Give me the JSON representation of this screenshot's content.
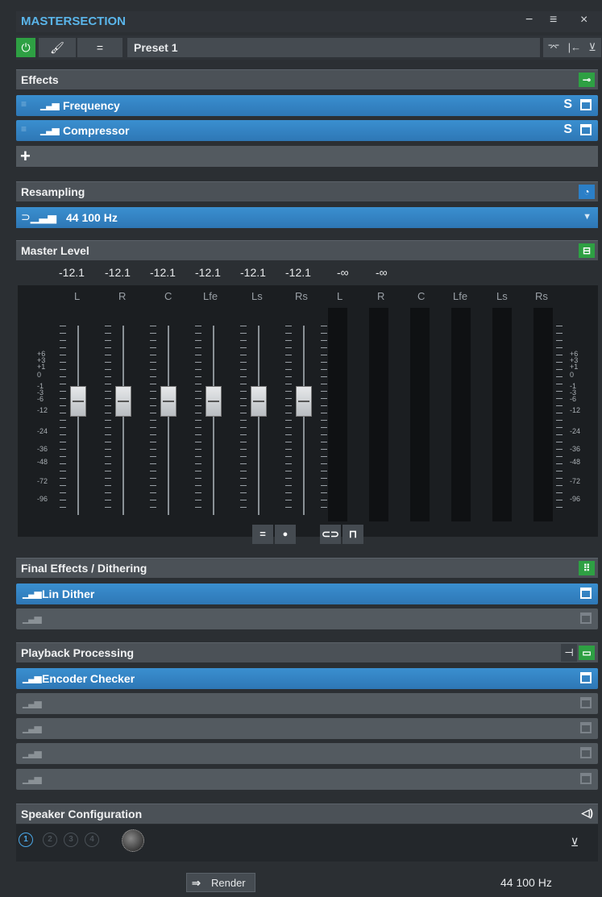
{
  "window": {
    "title": "MASTERSECTION",
    "minimize_label": "−",
    "menu_label": "≡",
    "close_label": "×"
  },
  "toolbar": {
    "power_label": "⏻",
    "brush_label": "🖌",
    "list_label": "=",
    "preset_value": "Preset 1",
    "btn_a": "⌤",
    "btn_b": "|←",
    "btn_c": "⊻"
  },
  "effects": {
    "header": "Effects",
    "slots": [
      {
        "name": "Frequency",
        "solo": "S"
      },
      {
        "name": "Compressor",
        "solo": "S"
      }
    ],
    "add_label": "+"
  },
  "resampling": {
    "header": "Resampling",
    "value": "44 100 Hz"
  },
  "master_level": {
    "header": "Master Level",
    "peaks": [
      "-12.1",
      "-12.1",
      "-12.1",
      "-12.1",
      "-12.1",
      "-12.1",
      "-∞",
      "-∞"
    ],
    "channels_left": [
      "L",
      "R",
      "C",
      "Lfe",
      "Ls",
      "Rs"
    ],
    "channels_right": [
      "L",
      "R",
      "C",
      "Lfe",
      "Ls",
      "Rs"
    ],
    "scale_left": [
      "+6",
      "+3",
      "+1",
      "0",
      "-1",
      "-3",
      "-6",
      "-12",
      "-24",
      "-36",
      "-48",
      "-72",
      "-96"
    ],
    "scale_right": [
      "+6",
      "+3",
      "+1",
      "0",
      "-1",
      "-3",
      "-6",
      "-12",
      "-24",
      "-36",
      "-48",
      "-72",
      "-96"
    ],
    "btn_equal": "=",
    "btn_drop": "💧",
    "btn_link": "⛓",
    "btn_lock": "🔓"
  },
  "final_effects": {
    "header": "Final Effects / Dithering",
    "slots": [
      {
        "name": "Lin Dither"
      },
      {
        "name": ""
      }
    ]
  },
  "playback": {
    "header": "Playback Processing",
    "slots": [
      {
        "name": "Encoder Checker"
      },
      {
        "name": ""
      },
      {
        "name": ""
      },
      {
        "name": ""
      },
      {
        "name": ""
      }
    ]
  },
  "speaker": {
    "header": "Speaker Configuration",
    "icon": "◁)",
    "configs": [
      "1",
      "2",
      "3",
      "4"
    ],
    "apply_label": "⊻"
  },
  "footer": {
    "render_label": "Render",
    "sample_rate": "44 100 Hz"
  }
}
